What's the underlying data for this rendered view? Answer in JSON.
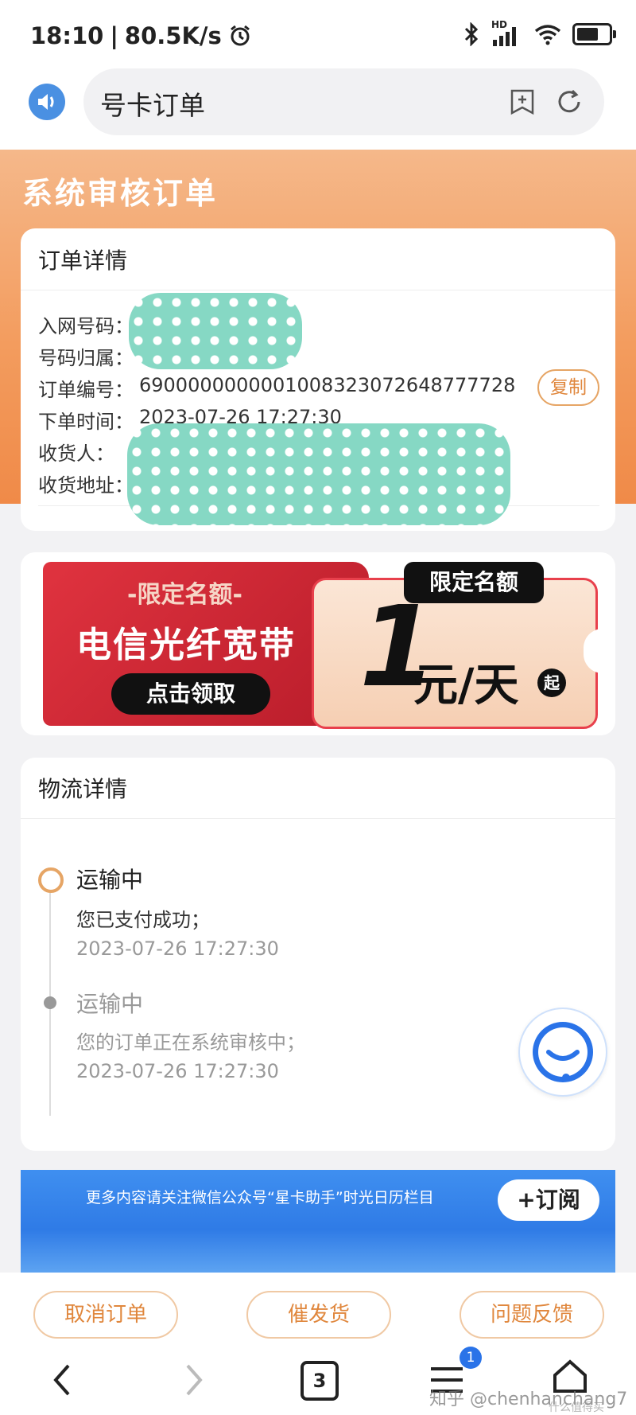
{
  "status_bar": {
    "time": "18:10",
    "speed": "80.5K/s",
    "network": "HD"
  },
  "browser": {
    "page_title": "号卡订单"
  },
  "hero": {
    "title": "系统审核订单"
  },
  "order_details": {
    "heading": "订单详情",
    "rows": [
      {
        "label": "入网号码：",
        "value": ""
      },
      {
        "label": "号码归属：",
        "value": ""
      },
      {
        "label": "订单编号：",
        "value": "6900000000001008323072648777728"
      },
      {
        "label": "下单时间：",
        "value": "2023-07-26 17:27:30"
      },
      {
        "label": "收货人：",
        "value": ""
      },
      {
        "label": "收货地址：",
        "value": ""
      }
    ],
    "copy_label": "复制"
  },
  "promo": {
    "tag": "-限定名额-",
    "title": "电信光纤宽带",
    "cta": "点击领取",
    "badge": "限定名额",
    "price_num": "1",
    "price_unit": "元/天",
    "price_suffix": "起"
  },
  "logistics": {
    "heading": "物流详情",
    "items": [
      {
        "status": "运输中",
        "desc": "您已支付成功；",
        "time": "2023-07-26 17:27:30"
      },
      {
        "status": "运输中",
        "desc": "您的订单正在系统审核中；",
        "time": "2023-07-26 17:27:30"
      }
    ]
  },
  "subscribe_banner": {
    "text": "更多内容请关注微信公众号“星卡助手”时光日历栏目",
    "button": "+订阅"
  },
  "actions": {
    "cancel": "取消订单",
    "urge": "催发货",
    "feedback": "问题反馈"
  },
  "bottom_nav": {
    "tabs_count": "3",
    "menu_badge": "1"
  },
  "watermark": {
    "handle": "知乎 @chenhanchang7",
    "site": "什么值得买"
  },
  "colors": {
    "accent": "#e0873d",
    "hero_gradient_top": "#f5b88a",
    "hero_gradient_bottom": "#f08a48",
    "banner_blue": "#3a8ef0",
    "promo_red": "#d22a35"
  }
}
